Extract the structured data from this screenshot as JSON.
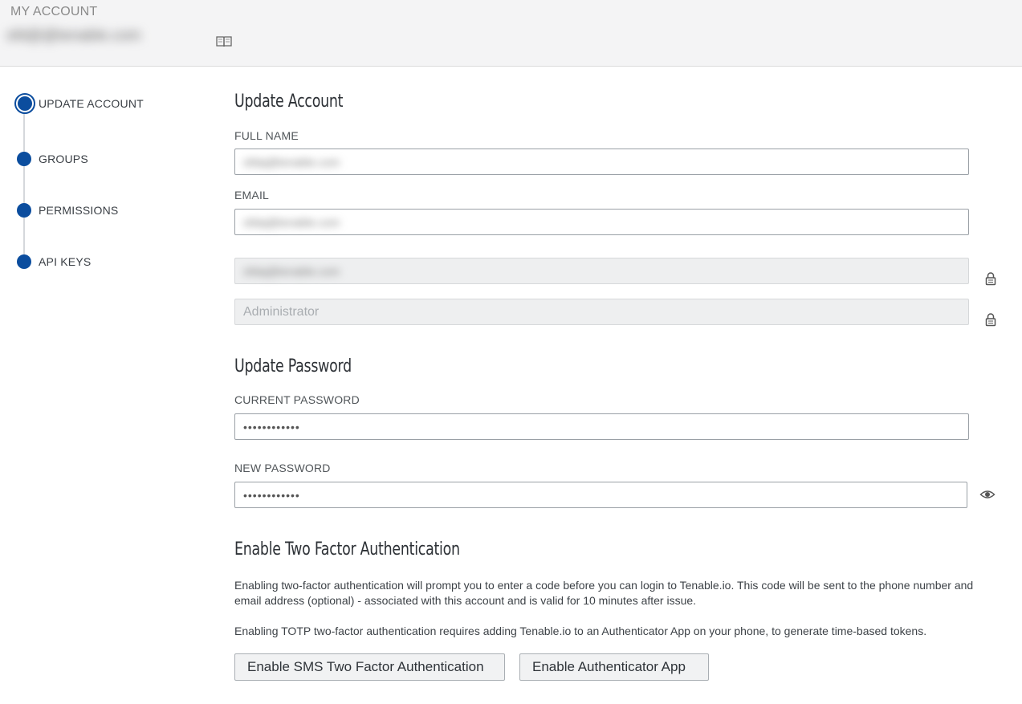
{
  "header": {
    "title": "MY ACCOUNT",
    "email": "sfd@@tenable.com"
  },
  "sidebar": {
    "items": [
      {
        "label": "UPDATE ACCOUNT",
        "active": true
      },
      {
        "label": "GROUPS",
        "active": false
      },
      {
        "label": "PERMISSIONS",
        "active": false
      },
      {
        "label": "API KEYS",
        "active": false
      }
    ]
  },
  "update_account": {
    "title": "Update Account",
    "full_name_label": "FULL NAME",
    "full_name_value": "sfdaj@tenable.com",
    "email_label": "EMAIL",
    "email_value": "sfdaj@tenable.com",
    "username_value": "sfdaj@tenable.com",
    "role_value": "Administrator"
  },
  "update_password": {
    "title": "Update Password",
    "current_label": "CURRENT PASSWORD",
    "current_value": "••••••••••••",
    "new_label": "NEW PASSWORD",
    "new_value": "••••••••••••"
  },
  "two_factor": {
    "title": "Enable Two Factor Authentication",
    "para1": "Enabling two-factor authentication will prompt you to enter a code before you can login to Tenable.io.  This code will be sent to the phone number and email address (optional) - associated with this account and is valid for 10 minutes after issue.",
    "para2": "Enabling TOTP two-factor authentication requires adding Tenable.io to an Authenticator App on your phone, to generate time-based tokens.",
    "sms_button": "Enable SMS Two Factor Authentication",
    "app_button": "Enable Authenticator App"
  },
  "icons": {
    "header_book": "book-icon",
    "lock": "lock-icon",
    "eye": "eye-icon"
  },
  "colors": {
    "accent": "#0b4d9e",
    "header_bg": "#f4f4f5"
  }
}
